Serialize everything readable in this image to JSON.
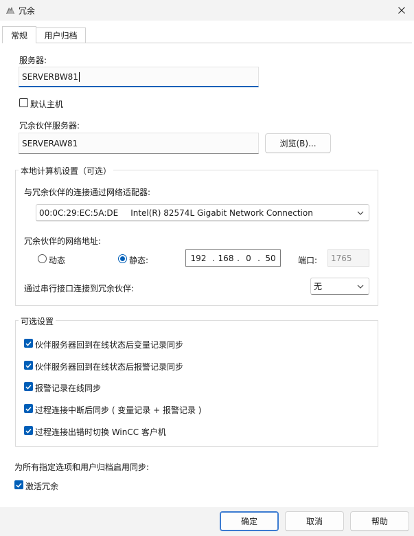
{
  "window": {
    "title": "冗余",
    "icon": "redundancy-app-icon",
    "close_icon": "close-icon"
  },
  "tabs": [
    {
      "label": "常规",
      "active": true
    },
    {
      "label": "用户归档",
      "active": false
    }
  ],
  "general": {
    "server_label": "服务器:",
    "server_value": "SERVERBW81",
    "default_master_label": "默认主机",
    "default_master_checked": false,
    "partner_label": "冗余伙伴服务器:",
    "partner_value": "SERVERAW81",
    "browse_label": "浏览(B)...",
    "local_group": {
      "title": "本地计算机设置（可选）",
      "adapter_label": "与冗余伙伴的连接通过网络适配器:",
      "adapter_mac": "00:0C:29:EC:5A:DE",
      "adapter_name": "Intel(R) 82574L Gigabit Network Connection",
      "address_label": "冗余伙伴的网络地址:",
      "dynamic_label": "动态",
      "static_label": "静态:",
      "selected_mode": "static",
      "ip_octets": [
        "192",
        "168",
        "0",
        "50"
      ],
      "port_label": "端口:",
      "port_value": "1765",
      "serial_label": "通过串行接口连接到冗余伙伴:",
      "serial_value": "无"
    },
    "optional_group": {
      "title": "可选设置",
      "options": [
        {
          "label": "伙伴服务器回到在线状态后变量记录同步",
          "checked": true
        },
        {
          "label": "伙伴服务器回到在线状态后报警记录同步",
          "checked": true
        },
        {
          "label": "报警记录在线同步",
          "checked": true
        },
        {
          "label": "过程连接中断后同步 ( 变量记录 + 报警记录 )",
          "checked": true
        },
        {
          "label": "过程连接出错时切换 WinCC 客户机",
          "checked": true
        }
      ]
    },
    "sync_all_label": "为所有指定选项和用户归档启用同步:",
    "activate_label": "激活冗余",
    "activate_checked": true
  },
  "footer": {
    "ok_label": "确定",
    "cancel_label": "取消",
    "help_label": "帮助"
  },
  "colors": {
    "accent": "#005fb8",
    "focus_border": "#3b7bd1"
  }
}
